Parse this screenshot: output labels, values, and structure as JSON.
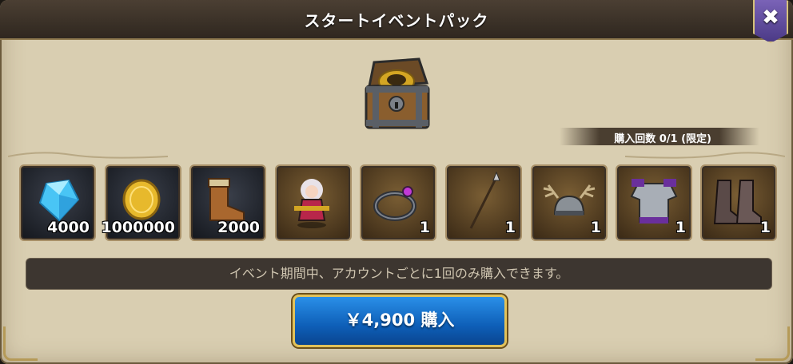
{
  "dialog": {
    "title": "スタートイベントパック",
    "close_label": "✖",
    "purchase_count": "購入回数 0/1 (限定)",
    "notice": "イベント期間中、アカウントごとに1回のみ購入できます。",
    "buy_label": "￥4,900 購入"
  },
  "items": [
    {
      "icon": "diamond-icon",
      "qty": "4000"
    },
    {
      "icon": "gold-coin-icon",
      "qty": "1000000"
    },
    {
      "icon": "boots-icon",
      "qty": "2000"
    },
    {
      "icon": "hero-character-icon",
      "qty": ""
    },
    {
      "icon": "ring-icon",
      "qty": "1"
    },
    {
      "icon": "spear-icon",
      "qty": "1"
    },
    {
      "icon": "antler-helmet-icon",
      "qty": "1"
    },
    {
      "icon": "armor-icon",
      "qty": "1"
    },
    {
      "icon": "greaves-icon",
      "qty": "1"
    }
  ],
  "colors": {
    "panel": "#d9ceb1",
    "header": "#3a3028",
    "buy_button": "#1677d6",
    "gold_border": "#e2c25a",
    "close_button": "#5e49a0"
  }
}
